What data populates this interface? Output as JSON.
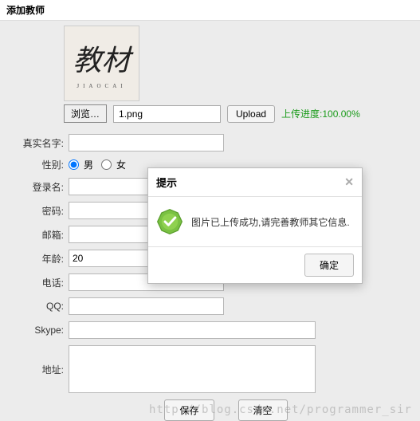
{
  "header": {
    "title": "添加教师"
  },
  "thumb": {
    "main": "教材",
    "sub": "JIAOCAI"
  },
  "upload": {
    "browse_label": "浏览…",
    "file_name": "1.png",
    "upload_label": "Upload",
    "progress_text": "上传进度:100.00%"
  },
  "form": {
    "realname": {
      "label": "真实名字:",
      "value": ""
    },
    "gender": {
      "label": "性别:",
      "male": "男",
      "female": "女",
      "selected": "male"
    },
    "login": {
      "label": "登录名:",
      "value": ""
    },
    "password": {
      "label": "密码:",
      "value": ""
    },
    "email": {
      "label": "邮箱:",
      "value": ""
    },
    "age": {
      "label": "年龄:",
      "value": "20"
    },
    "phone": {
      "label": "电话:",
      "value": ""
    },
    "qq": {
      "label": "QQ:",
      "value": ""
    },
    "skype": {
      "label": "Skype:",
      "value": ""
    },
    "address": {
      "label": "地址:",
      "value": ""
    }
  },
  "buttons": {
    "save": "保存",
    "clear": "清空"
  },
  "dialog": {
    "title": "提示",
    "message": "图片已上传成功,请完善教师其它信息.",
    "ok": "确定"
  },
  "watermark": "http://blog.csdn.net/programmer_sir"
}
